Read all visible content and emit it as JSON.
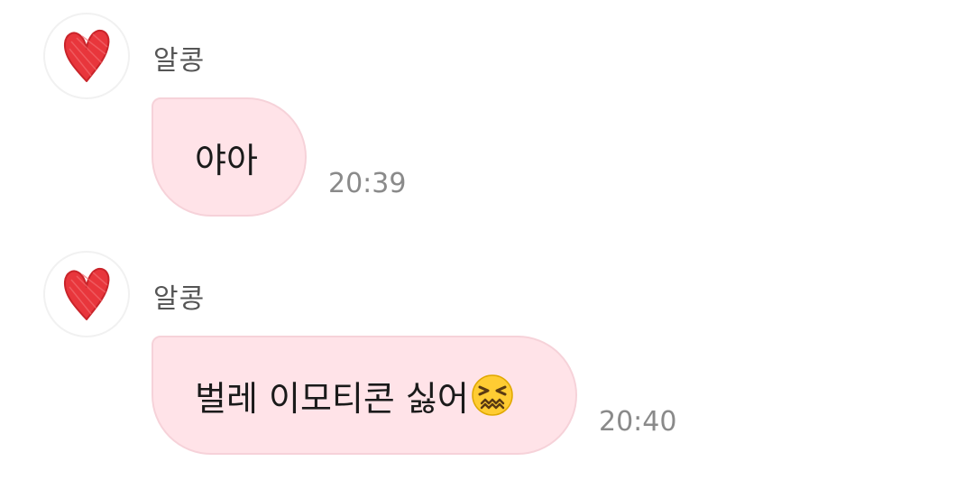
{
  "messages": [
    {
      "sender": "알콩",
      "avatar_icon": "red-heart-doodle-icon",
      "text": "야아",
      "time": "20:39"
    },
    {
      "sender": "알콩",
      "avatar_icon": "red-heart-doodle-icon",
      "text": "벌레 이모티콘 싫어",
      "emoji_icon": "confounded-face-emoji",
      "time": "20:40"
    }
  ],
  "colors": {
    "bubble_background": "#ffe3e8",
    "bubble_border": "#f6d2d9",
    "heart": "#e8363c",
    "sender_text": "#555555",
    "time_text": "#8a8a8a"
  }
}
